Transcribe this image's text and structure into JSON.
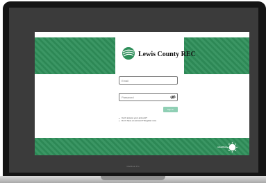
{
  "brand": {
    "name": "Lewis County REC",
    "green": "#2f8f5a",
    "accent_light": "#8fcfb4",
    "logo_icon": "globe-swoosh-logo"
  },
  "login": {
    "email_placeholder": "Email",
    "password_placeholder": "Password",
    "password_toggle_icon": "eye-icon",
    "signin_label": "Sign In",
    "links": [
      "Can't access your account?",
      "Don't have an account? Register now."
    ]
  },
  "footer": {
    "badge_text": "smarthub",
    "badge_icon": "sun-circle-icon"
  },
  "device": {
    "caption": "MacBook Pro"
  }
}
